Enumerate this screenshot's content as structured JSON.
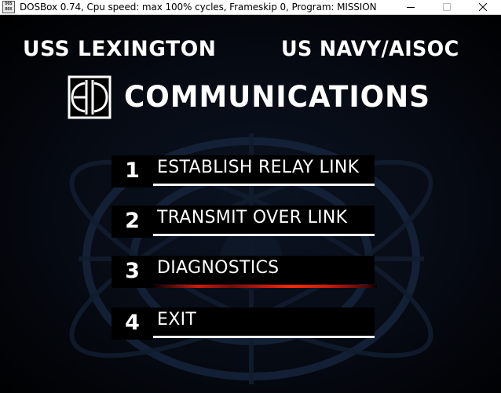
{
  "window": {
    "title": "DOSBox 0.74, Cpu speed: max 100% cycles, Frameskip  0, Program:  MISSION",
    "icon_label": "DOS BOX",
    "controls": {
      "minimize": "minimize-icon",
      "maximize": "maximize-icon",
      "close": "close-icon"
    }
  },
  "header": {
    "left": "USS LEXINGTON",
    "right": "US NAVY/AISOC",
    "title": "COMMUNICATIONS",
    "logo_icon": "communications-logo-icon"
  },
  "menu": {
    "items": [
      {
        "number": "1",
        "label": "ESTABLISH RELAY LINK",
        "selected": false
      },
      {
        "number": "2",
        "label": "TRANSMIT OVER LINK",
        "selected": false
      },
      {
        "number": "3",
        "label": "DIAGNOSTICS",
        "selected": true
      },
      {
        "number": "4",
        "label": "EXIT",
        "selected": false
      }
    ]
  },
  "colors": {
    "background": "#000000",
    "text": "#ffffff",
    "selection_accent": "#d01a00",
    "emblem": "#16243a"
  }
}
